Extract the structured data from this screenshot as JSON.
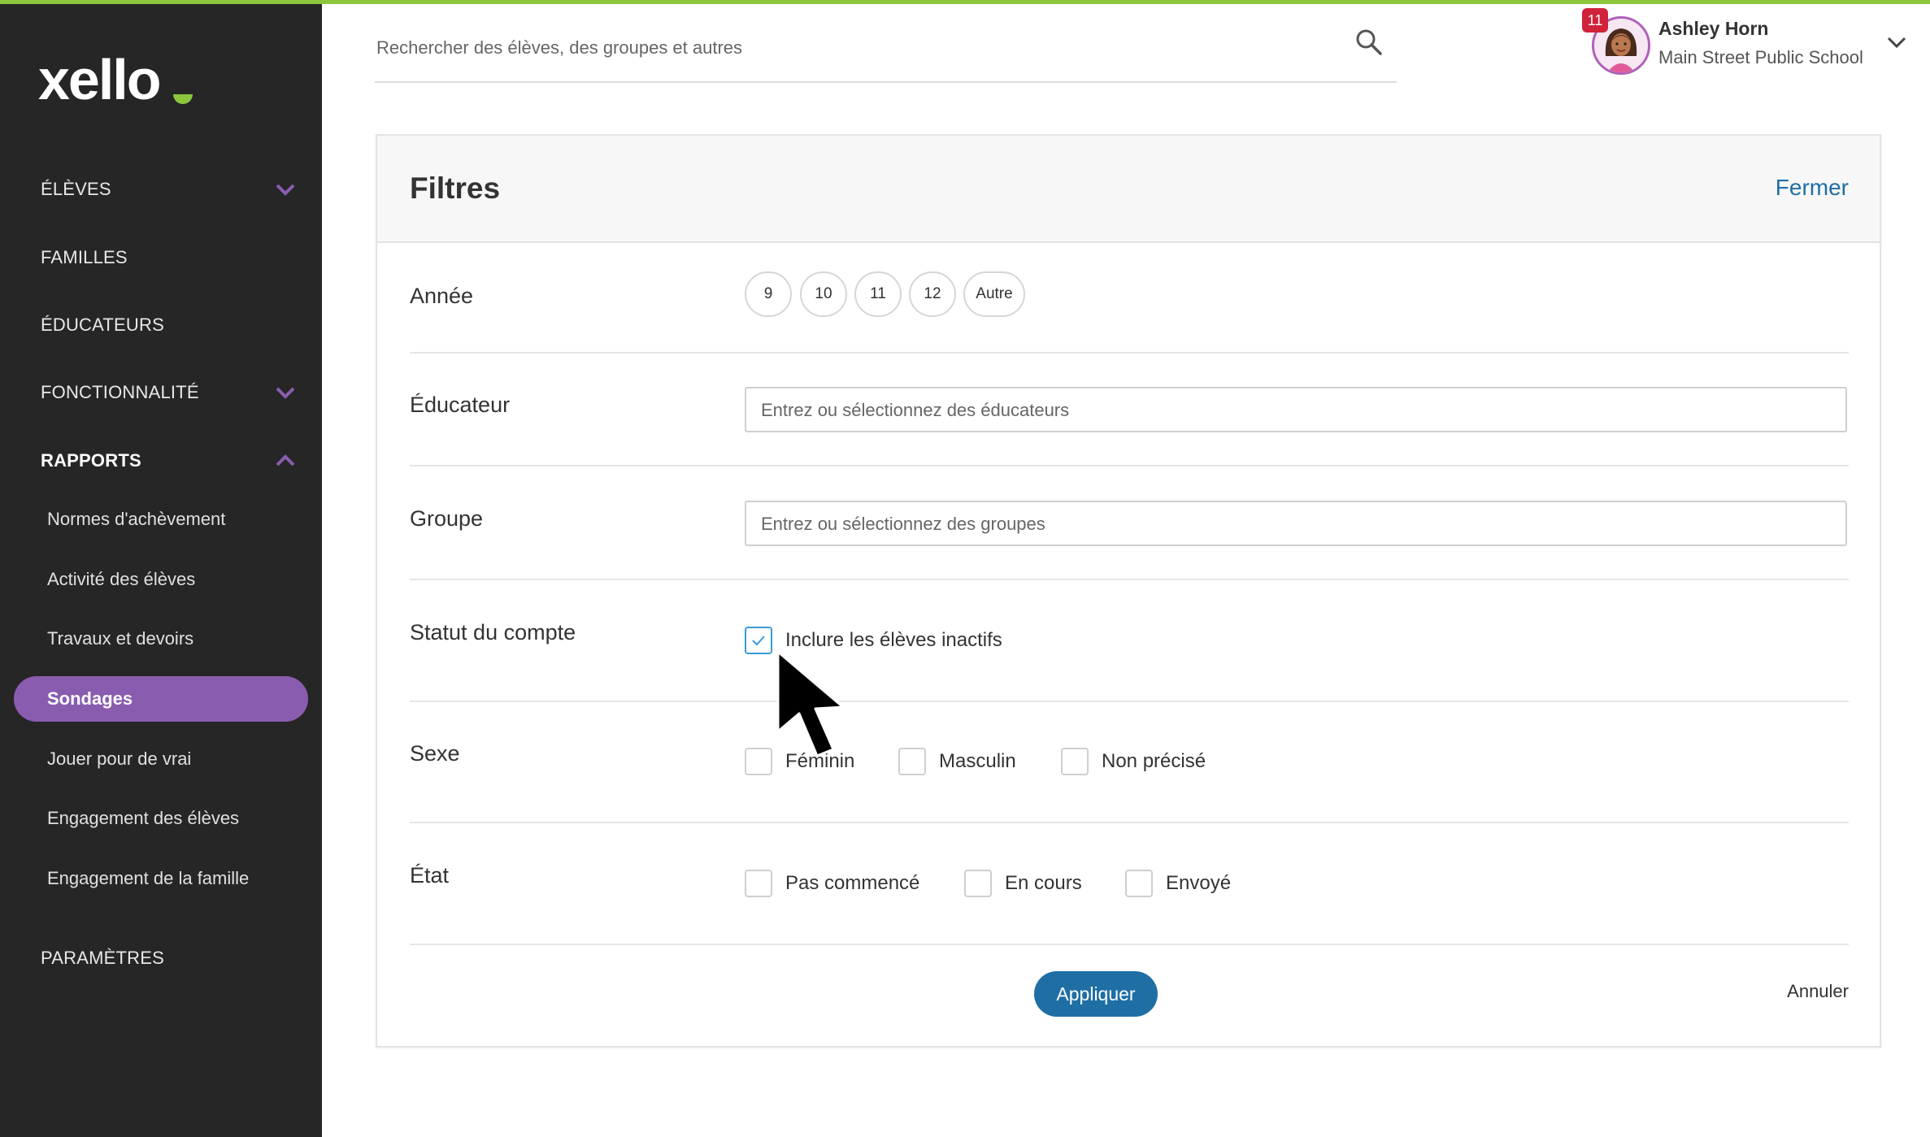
{
  "app": {
    "logo_text": "xello"
  },
  "sidebar": {
    "items": [
      {
        "label": "ÉLÈVES"
      },
      {
        "label": "FAMILLES"
      },
      {
        "label": "ÉDUCATEURS"
      },
      {
        "label": "FONCTIONNALITÉ"
      },
      {
        "label": "RAPPORTS"
      },
      {
        "label": "PARAMÈTRES"
      }
    ],
    "reports_sub": [
      {
        "label": "Normes d'achèvement"
      },
      {
        "label": "Activité des élèves"
      },
      {
        "label": "Travaux et devoirs"
      },
      {
        "label": "Sondages"
      },
      {
        "label": "Jouer pour de vrai"
      },
      {
        "label": "Engagement des élèves"
      },
      {
        "label": "Engagement de la famille"
      }
    ],
    "active_item": "Sondages"
  },
  "search": {
    "placeholder": "Rechercher des élèves, des groupes et autres"
  },
  "user": {
    "name": "Ashley Horn",
    "school": "Main Street Public School",
    "notifications": "11"
  },
  "filters": {
    "title": "Filtres",
    "close_label": "Fermer",
    "year": {
      "label": "Année",
      "chips": [
        "9",
        "10",
        "11",
        "12",
        "Autre"
      ]
    },
    "educator": {
      "label": "Éducateur",
      "placeholder": "Entrez ou sélectionnez des éducateurs"
    },
    "group": {
      "label": "Groupe",
      "placeholder": "Entrez ou sélectionnez des groupes"
    },
    "account_status": {
      "label": "Statut du compte",
      "option": "Inclure les élèves inactifs",
      "checked": true
    },
    "sex": {
      "label": "Sexe",
      "options": [
        "Féminin",
        "Masculin",
        "Non précisé"
      ]
    },
    "state": {
      "label": "État",
      "options": [
        "Pas commencé",
        "En cours",
        "Envoyé"
      ]
    },
    "apply_label": "Appliquer",
    "cancel_label": "Annuler"
  },
  "colors": {
    "accent_green": "#8cc63f",
    "sidebar_bg": "#262626",
    "active_purple": "#8a5cb0",
    "link_blue": "#1f6fa5",
    "checkbox_blue": "#3a9ad9",
    "badge_red": "#d0223b"
  }
}
